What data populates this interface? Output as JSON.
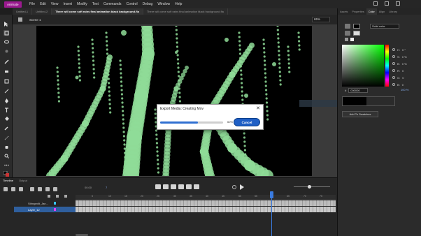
{
  "app": {
    "badge": "Animate"
  },
  "menu": [
    "File",
    "Edit",
    "View",
    "Insert",
    "Modify",
    "Text",
    "Commands",
    "Control",
    "Debug",
    "Window",
    "Help"
  ],
  "doc_tabs": [
    {
      "label": "Untitled-1",
      "active": false
    },
    {
      "label": "Untitled-2",
      "active": false
    },
    {
      "label": "There will come soft rains final animation black background.fla",
      "active": true
    },
    {
      "label": "There will come soft rains final animation black background.fla",
      "active": false
    }
  ],
  "stage": {
    "scene_label": "Scene 1",
    "zoom": "65%",
    "background": "#000000",
    "drop_color": "#8fdc98"
  },
  "dialog": {
    "title": "Export Media: Creating Mov",
    "progress_pct": 0.6,
    "progress_text": "60%",
    "cancel_label": "Cancel"
  },
  "right_panel": {
    "tabs": [
      {
        "label": "Assets",
        "active": false
      },
      {
        "label": "Properties",
        "active": false
      },
      {
        "label": "Color",
        "active": true
      },
      {
        "label": "Align",
        "active": false
      },
      {
        "label": "Library",
        "active": false
      }
    ],
    "fill_type": "Solid color",
    "hsb": [
      {
        "label": "H:",
        "value": "0 °"
      },
      {
        "label": "S:",
        "value": "0 %"
      },
      {
        "label": "B:",
        "value": "0 %"
      },
      {
        "label": "R:",
        "value": "0"
      },
      {
        "label": "G:",
        "value": "0"
      },
      {
        "label": "B:",
        "value": "0"
      }
    ],
    "hex_prefix": "#",
    "hex_value": "000000",
    "alpha": "100 %",
    "add_swatch_label": "Add To Swatches"
  },
  "timeline": {
    "tabs": [
      {
        "label": "Timeline",
        "active": true
      },
      {
        "label": "Output",
        "active": false
      }
    ],
    "fps": "00.00",
    "frame_number": "7",
    "layers": [
      {
        "name": "Stringedit_Jan...",
        "selected": false
      },
      {
        "name": "Layer_12",
        "selected": true
      }
    ],
    "ruler_marks": [
      "5",
      "10",
      "15",
      "20",
      "25",
      "30",
      "35",
      "40",
      "45",
      "50",
      "55",
      "60",
      "65",
      "70",
      "75"
    ]
  },
  "icons": [
    "arrow-icon",
    "subselect-icon",
    "free-transform-icon",
    "lasso-icon",
    "brush-icon",
    "eraser-icon",
    "rectangle-icon",
    "line-icon",
    "pen-icon",
    "text-icon",
    "paint-bucket-icon",
    "eyedropper-icon",
    "hand-icon",
    "zoom-icon",
    "more-icon"
  ]
}
